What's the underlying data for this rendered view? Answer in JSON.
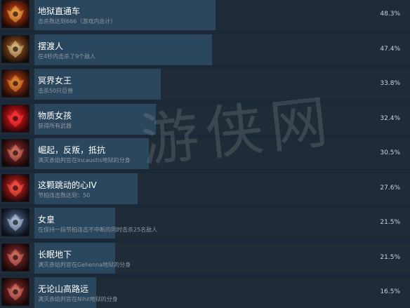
{
  "achievements": [
    {
      "title": "地狱直通车",
      "desc": "击杀数达到666（游戏内总计）",
      "percent_text": "48.3%",
      "percent": 48.3,
      "icon": "fire-portal-icon",
      "colors": [
        "#f4b04a",
        "#8a2b0c",
        "#1c0705"
      ]
    },
    {
      "title": "摆渡人",
      "desc": "在4秒内击杀了9个敌人",
      "percent_text": "47.4%",
      "percent": 47.4,
      "icon": "skull-icon",
      "colors": [
        "#e6c78a",
        "#6b3b18",
        "#120b07"
      ]
    },
    {
      "title": "冥界女王",
      "desc": "击杀50只巨兽",
      "percent_text": "33.8%",
      "percent": 33.8,
      "icon": "demon-queen-icon",
      "colors": [
        "#f0903a",
        "#7a2a10",
        "#1a0805"
      ]
    },
    {
      "title": "物质女孩",
      "desc": "获得所有武器",
      "percent_text": "32.4%",
      "percent": 32.4,
      "icon": "weapon-icon",
      "colors": [
        "#ff3a3a",
        "#a30f14",
        "#2a0406"
      ]
    },
    {
      "title": "崛起，反叛，抵抗",
      "desc": "满灭赤焰判官在Incaustis地狱的分身",
      "percent_text": "30.5%",
      "percent": 30.5,
      "icon": "judge-icon",
      "colors": [
        "#e07a6a",
        "#5c1c1c",
        "#160707"
      ]
    },
    {
      "title": "这颗跳动的心IV",
      "desc": "节拍连击数达到：50",
      "percent_text": "27.6%",
      "percent": 27.6,
      "icon": "heart-icon",
      "colors": [
        "#ff5a4a",
        "#8c1616",
        "#1e0505"
      ]
    },
    {
      "title": "女皇",
      "desc": "在保持一段节拍连击不中断的同时击杀25名敌人",
      "percent_text": "21.5%",
      "percent": 21.5,
      "icon": "empress-icon",
      "colors": [
        "#b9c9e6",
        "#34445e",
        "#0b0f18"
      ]
    },
    {
      "title": "长眠地下",
      "desc": "满灭赤焰判官在Gehenna地狱的分身",
      "percent_text": "21.5%",
      "percent": 21.5,
      "icon": "judge-icon",
      "colors": [
        "#e07a6a",
        "#5c1c1c",
        "#160707"
      ]
    },
    {
      "title": "无论山高路远",
      "desc": "满灭赤焰判官在Nihil地狱的分身",
      "percent_text": "16.5%",
      "percent": 16.5,
      "icon": "judge-icon",
      "colors": [
        "#e07a6a",
        "#5c1c1c",
        "#160707"
      ]
    }
  ],
  "watermark": "游侠网"
}
